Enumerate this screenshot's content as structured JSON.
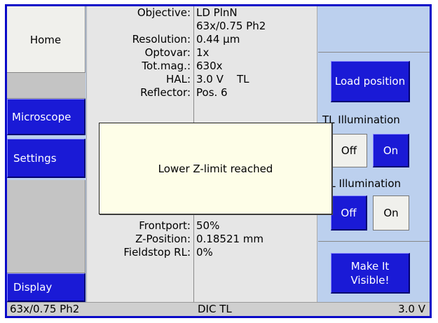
{
  "nav": {
    "home": "Home",
    "microscope": "Microscope",
    "settings": "Settings",
    "display": "Display"
  },
  "info": {
    "rows": [
      {
        "label": "Objective:",
        "value": "LD PlnN"
      },
      {
        "label": "",
        "value": "63x/0.75 Ph2"
      },
      {
        "label": "Resolution:",
        "value": "0.44 µm"
      },
      {
        "label": "Optovar:",
        "value": "1x"
      },
      {
        "label": "Tot.mag.:",
        "value": "630x"
      },
      {
        "label": "HAL:",
        "value": "3.0 V    TL"
      },
      {
        "label": "Reflector:",
        "value": "Pos. 6"
      },
      {
        "label": "Frontport:",
        "value": "50%"
      },
      {
        "label": "Z-Position:",
        "value": "0.18521 mm"
      },
      {
        "label": "Fieldstop RL:",
        "value": "0%"
      }
    ]
  },
  "right": {
    "load_position": "Load position",
    "tl_illumination": "TL Illumination",
    "tl_off": "Off",
    "tl_on": "On",
    "rl_illumination": "RL Illumination",
    "rl_off": "Off",
    "rl_on": "On",
    "make_visible": "Make It Visible!"
  },
  "status": {
    "objective": "63x/0.75 Ph2",
    "contrast": "DIC TL",
    "voltage": "3.0 V"
  },
  "dialog": {
    "message": "Lower Z-limit reached"
  },
  "colors": {
    "button_blue": "#1a1ad6",
    "panel_blue": "#bcd0ee",
    "frame_blue": "#0a0ac8",
    "dialog_bg": "#fefee8"
  }
}
